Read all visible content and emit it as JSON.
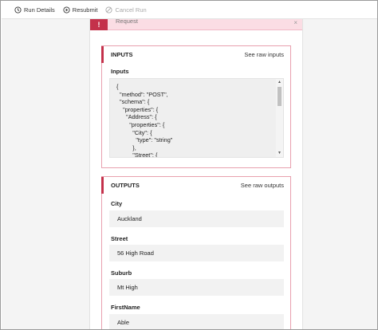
{
  "toolbar": {
    "run_details": "Run Details",
    "resubmit": "Resubmit",
    "cancel_run": "Cancel Run"
  },
  "trigger": {
    "title": "Request",
    "close": "×"
  },
  "inputs": {
    "title": "INPUTS",
    "raw_link": "See raw inputs",
    "field_label": "Inputs",
    "code": "{\n  \"method\": \"POST\",\n  \"schema\": {\n    \"properties\": {\n      \"Address\": {\n        \"properties\": {\n          \"City\": {\n            \"type\": \"string\"\n          },\n          \"Street\": {"
  },
  "outputs": {
    "title": "OUTPUTS",
    "raw_link": "See raw outputs",
    "fields": [
      {
        "label": "City",
        "value": "Auckland"
      },
      {
        "label": "Street",
        "value": "56 High Road"
      },
      {
        "label": "Suburb",
        "value": "Mt High"
      },
      {
        "label": "FirstName",
        "value": "Able"
      }
    ]
  },
  "colors": {
    "accent": "#c4314b",
    "accent_light": "#fbdde4",
    "section_border": "#e8a0ae"
  }
}
